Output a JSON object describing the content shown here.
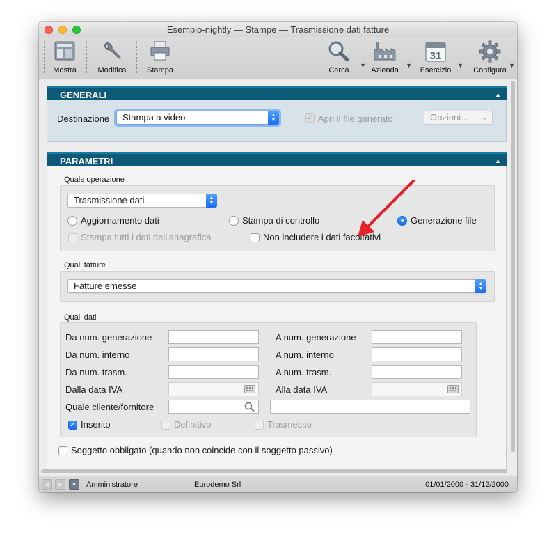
{
  "window": {
    "title": "Esempio-nightly — Stampe — Trasmissione dati fatture"
  },
  "toolbar": {
    "mostra": "Mostra",
    "modifica": "Modifica",
    "stampa": "Stampa",
    "cerca": "Cerca",
    "azienda": "Azienda",
    "esercizio": "Esercizio",
    "esercizio_day": "31",
    "configura": "Configura"
  },
  "generali": {
    "title": "GENERALI",
    "destinazione_label": "Destinazione",
    "destinazione_value": "Stampa a video",
    "apri_file_label": "Apri il file generato",
    "opzioni_label": "Opzioni..."
  },
  "parametri": {
    "title": "PARAMETRI",
    "quale_operazione": {
      "title": "Quale operazione",
      "value": "Trasmissione dati",
      "radio_aggiornamento": "Aggiornamento dati",
      "radio_stampa_controllo": "Stampa di controllo",
      "radio_generazione": "Generazione file",
      "chk_stampa_tutti": "Stampa tutti i dati dell'anagrafica",
      "chk_non_includere": "Non includere i dati facoltativi"
    },
    "quali_fatture": {
      "title": "Quali fatture",
      "value": "Fatture emesse"
    },
    "quali_dati": {
      "title": "Quali dati",
      "da_num_generazione": "Da num. generazione",
      "a_num_generazione": "A num. generazione",
      "da_num_interno": "Da num. interno",
      "a_num_interno": "A num. interno",
      "da_num_trasm": "Da num. trasm.",
      "a_num_trasm": "A num. trasm.",
      "dalla_data_iva": "Dalla data IVA",
      "alla_data_iva": "Alla data IVA",
      "quale_cliente": "Quale cliente/fornitore",
      "chk_inserito": "Inserito",
      "chk_definitivo": "Definitivo",
      "chk_trasmesso": "Trasmesso"
    },
    "chk_soggetto": "Soggetto obbligato (quando non coincide con il soggetto passivo)"
  },
  "status": {
    "user": "Amministratore",
    "company": "Eurodemo Srl",
    "period": "01/01/2000 - 31/12/2000"
  },
  "colors": {
    "section_header": "#0d5a78",
    "accent": "#1a6ef3",
    "annotation_arrow": "#e8202a"
  }
}
